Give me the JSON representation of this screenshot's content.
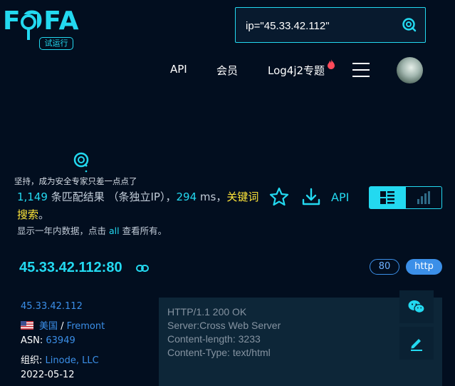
{
  "logo": {
    "text": "FOFA",
    "badge": "试运行"
  },
  "search": {
    "value": "ip=\"45.33.42.112\""
  },
  "nav": {
    "api": "API",
    "vip": "会员",
    "log4j2": "Log4j2专题"
  },
  "tip": {
    "text": "坚持，成为安全专家只差一点点了"
  },
  "results": {
    "count": "1,149",
    "label_match": " 条匹配结果 ",
    "label_unique": "（条独立IP）",
    "sep": "，",
    "ms": "294",
    "ms_unit": " ms，",
    "keyword": "关键词搜索",
    "end": "。",
    "sub_prefix": "显示一年内数据，点击 ",
    "sub_all": "all",
    "sub_suffix": " 查看所有。"
  },
  "actions": {
    "api": "API"
  },
  "item": {
    "host": "45.33.42.112:80",
    "port_tag": "80",
    "proto_tag": "http",
    "ip": "45.33.42.112",
    "country": "美国",
    "loc_sep": " / ",
    "city": "Fremont",
    "asn_label": "ASN: ",
    "asn": "63949",
    "org_label": "组织: ",
    "org": "Linode, LLC",
    "date": "2022-05-12",
    "banner": [
      "HTTP/1.1 200 OK",
      "Server:Cross Web Server",
      "Content-length: 3233",
      "Content-Type: text/html"
    ]
  },
  "colors": {
    "accent": "#23d9f0",
    "highlight": "#ffe63a",
    "link": "#3b8fe8",
    "background": "#020e1f"
  }
}
